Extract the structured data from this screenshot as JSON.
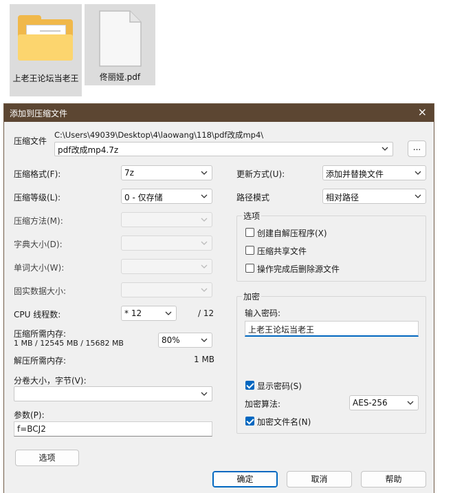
{
  "desktop": {
    "folder_label": "上老王论坛当老王",
    "pdf_label": "佟丽娅.pdf"
  },
  "dialog": {
    "title": "添加到压缩文件",
    "close_icon": "×",
    "archive_label": "压缩文件",
    "archive_path": "C:\\Users\\49039\\Desktop\\4\\laowang\\118\\pdf改成mp4\\",
    "archive_name": "pdf改成mp4.7z",
    "browse_label": "...",
    "format_label": "压缩格式(F):",
    "format_value": "7z",
    "level_label": "压缩等级(L):",
    "level_value": "0 - 仅存储",
    "method_label": "压缩方法(M):",
    "dict_label": "字典大小(D):",
    "word_label": "单词大小(W):",
    "solid_label": "固实数据大小:",
    "threads_label": "CPU 线程数:",
    "threads_value": "* 12",
    "threads_total": "/ 12",
    "mem_comp_label": "压缩所需内存:",
    "mem_comp_detail": "1 MB / 12545 MB / 15682 MB",
    "mem_percent": "80%",
    "mem_decomp_label": "解压所需内存:",
    "mem_decomp_value": "1 MB",
    "volume_label": "分卷大小，字节(V):",
    "volume_value": "",
    "params_label": "参数(P):",
    "params_value": "f=BCJ2",
    "options_button": "选项",
    "update_label": "更新方式(U):",
    "update_value": "添加并替换文件",
    "path_label": "路径模式",
    "path_value": "相对路径",
    "options_group": "选项",
    "opt_sfx": "创建自解压程序(X)",
    "opt_shared": "压缩共享文件",
    "opt_delete": "操作完成后删除源文件",
    "opt_sfx_checked": false,
    "opt_shared_checked": false,
    "opt_delete_checked": false,
    "encrypt_group": "加密",
    "password_label": "输入密码:",
    "password_value": "上老王论坛当老王",
    "show_password": "显示密码(S)",
    "show_password_checked": true,
    "encrypt_method_label": "加密算法:",
    "encrypt_method_value": "AES-256",
    "encrypt_names": "加密文件名(N)",
    "encrypt_names_checked": true,
    "ok_button": "确定",
    "cancel_button": "取消",
    "help_button": "帮助"
  }
}
